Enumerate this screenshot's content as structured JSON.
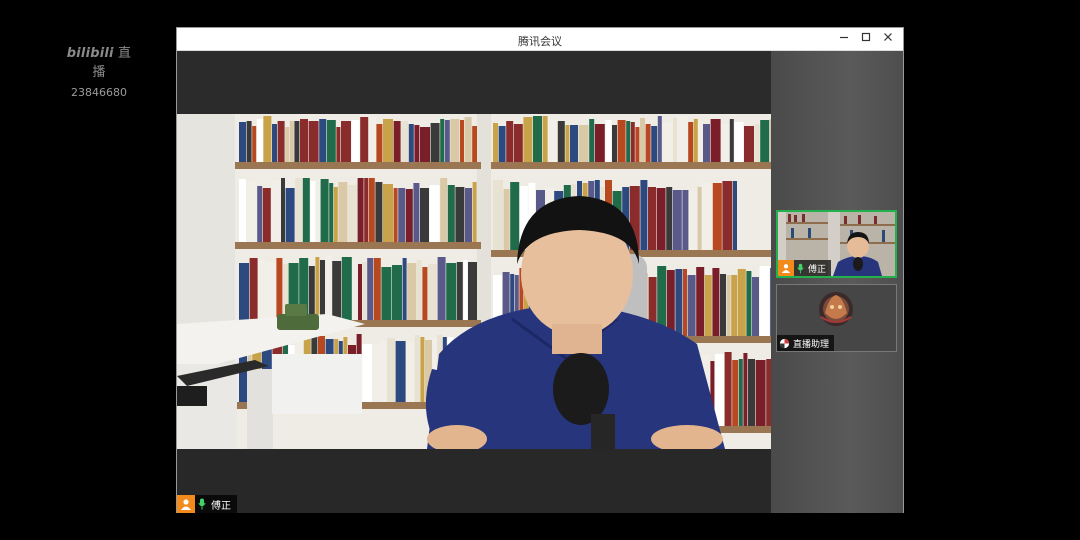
{
  "watermark": {
    "brand_logo": "bilibili",
    "brand_text": "直播",
    "room_id": "23846680"
  },
  "window": {
    "title": "腾讯会议",
    "controls": {
      "minimize": "—",
      "maximize": "☐",
      "close": "✕"
    }
  },
  "main_speaker": {
    "name": "傅正",
    "mic_state": "on",
    "avatar_icon": "person-icon"
  },
  "participants": [
    {
      "name": "傅正",
      "mic_state": "on",
      "active_speaker": true
    },
    {
      "name": "直播助理",
      "mic_state": "n/a",
      "active_speaker": false
    }
  ],
  "colors": {
    "active_border": "#22b14c",
    "avatar_orange": "#f28a1c",
    "mic_green": "#3fd36b"
  }
}
